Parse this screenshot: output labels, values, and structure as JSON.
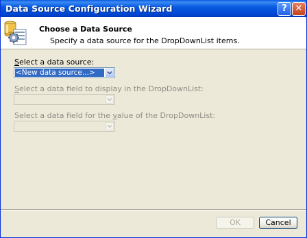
{
  "window": {
    "title": "Data Source Configuration Wizard",
    "help_glyph": "?",
    "close_glyph": "✕"
  },
  "header": {
    "title": "Choose a Data Source",
    "description": "Specify a data source for the DropDownList items."
  },
  "fields": {
    "data_source": {
      "label_hotkey": "S",
      "label_rest": "elect a data source:",
      "value": "<New data source...>",
      "enabled": true
    },
    "display_field": {
      "label_hotkey": "S",
      "label_rest": "elect a data field to display in the DropDownList:",
      "value": "",
      "enabled": false
    },
    "value_field": {
      "label_before": "Select a data field for the ",
      "label_hotkey": "v",
      "label_rest": "alue of the DropDownList:",
      "value": "",
      "enabled": false
    }
  },
  "buttons": {
    "ok": "OK",
    "cancel": "Cancel"
  },
  "colors": {
    "titlebar": "#0a5bdf",
    "selection": "#316ac5",
    "dialog_bg": "#ece9d8"
  },
  "icons": {
    "header_icon": "database-gear-icon",
    "dropdown": "chevron-down-icon"
  }
}
